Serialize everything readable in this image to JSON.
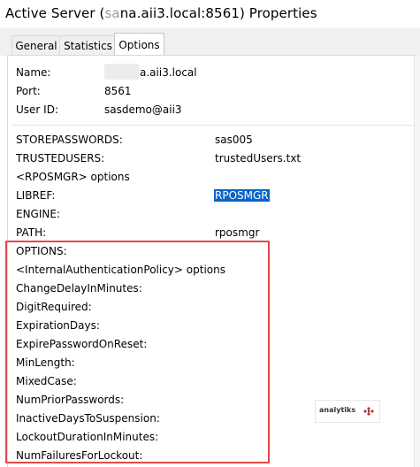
{
  "window": {
    "title": "Active Server (",
    "title_redacted": "sa",
    "title_rest": "na.aii3.local:8561) Properties"
  },
  "tabs": [
    {
      "label": "General",
      "active": false
    },
    {
      "label": "Statistics",
      "active": false
    },
    {
      "label": "Options",
      "active": true
    }
  ],
  "server": {
    "name_label": "Name:",
    "name_value": "a.aii3.local",
    "port_label": "Port:",
    "port_value": "8561",
    "userid_label": "User ID:",
    "userid_value": "sasdemo@aii3"
  },
  "options": {
    "storepasswords_label": "STOREPASSWORDS:",
    "storepasswords_value": "sas005",
    "trustedusers_label": "TRUSTEDUSERS:",
    "trustedusers_value": "trustedUsers.txt",
    "rposmgr_header": "<RPOSMGR> options",
    "libref_label": "LIBREF:",
    "libref_value": "RPOSMGR",
    "engine_label": "ENGINE:",
    "path_label": "PATH:",
    "path_value": "rposmgr",
    "options_label": "OPTIONS:",
    "iap_header": "<InternalAuthenticationPolicy> options",
    "policy_items": [
      "ChangeDelayInMinutes:",
      "DigitRequired:",
      "ExpirationDays:",
      "ExpirePasswordOnReset:",
      "MinLength:",
      "MixedCase:",
      "NumPriorPasswords:",
      "InactiveDaysToSuspension:",
      "LockoutDurationInMinutes:",
      "NumFailuresForLockout:"
    ]
  },
  "logo": {
    "text": "analytiks"
  },
  "colors": {
    "highlight": "#0a64c8",
    "annotation_box": "#e24a4a"
  }
}
